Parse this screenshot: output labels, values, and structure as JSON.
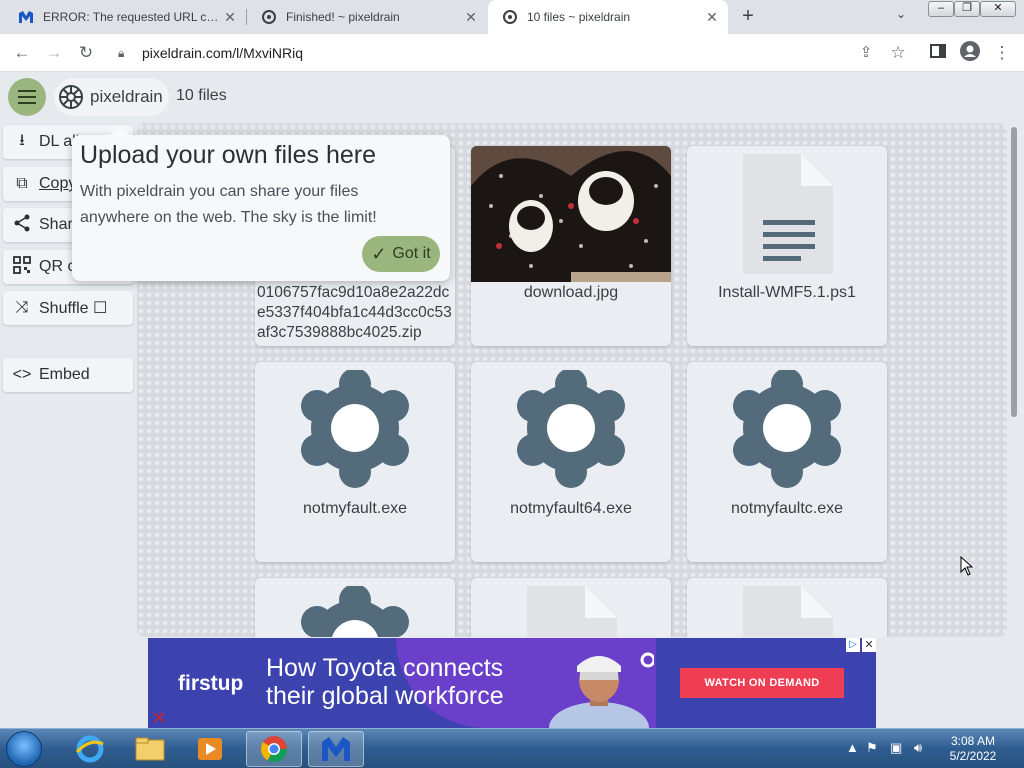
{
  "browser": {
    "tabs": [
      {
        "title": "ERROR: The requested URL could",
        "icon": "m-logo-icon"
      },
      {
        "title": "Finished! ~ pixeldrain",
        "icon": "pixeldrain-icon"
      },
      {
        "title": "10 files ~ pixeldrain",
        "icon": "pixeldrain-icon",
        "active": true
      }
    ],
    "new_tab": "+",
    "url": "pixeldrain.com/l/MxviNRiq"
  },
  "header": {
    "brand": "pixeldrain",
    "file_count": "10 files"
  },
  "sidebar": {
    "items": [
      {
        "label": "DL all",
        "icon": "download-icon"
      },
      {
        "label": "Copy",
        "icon": "copy-icon"
      },
      {
        "label": "Share",
        "icon": "share-icon"
      },
      {
        "label": "QR code",
        "icon": "qr-icon"
      },
      {
        "label": "Shuffle ☐",
        "icon": "shuffle-icon"
      },
      {
        "label": "Embed",
        "icon": "embed-icon"
      }
    ]
  },
  "tooltip": {
    "title": "Upload your own files here",
    "text": "With pixeldrain you can share your files anywhere on the web. The sky is the limit!",
    "button": "Got it"
  },
  "gallery": {
    "files": [
      {
        "name": "0106757fac9d10a8e2a22dce5337f404bfa1c44d3cc0c53af3c7539888bc4025.zip",
        "type": "zip"
      },
      {
        "name": "download.jpg",
        "type": "image"
      },
      {
        "name": "Install-WMF5.1.ps1",
        "type": "document"
      },
      {
        "name": "notmyfault.exe",
        "type": "executable"
      },
      {
        "name": "notmyfault64.exe",
        "type": "executable"
      },
      {
        "name": "notmyfaultc.exe",
        "type": "executable"
      },
      {
        "name": "",
        "type": "executable"
      },
      {
        "name": "",
        "type": "document"
      },
      {
        "name": "",
        "type": "document"
      }
    ]
  },
  "ad": {
    "brand": "firstup",
    "headline": "How Toyota connects their global workforce",
    "cta": "WATCH ON DEMAND"
  },
  "taskbar": {
    "time": "3:08 AM",
    "date": "5/2/2022"
  },
  "colors": {
    "accent": "#9ab57d",
    "icon_gray": "#546b7c",
    "ad_bg": "#3c42ae",
    "ad_cta": "#ef3e54"
  }
}
